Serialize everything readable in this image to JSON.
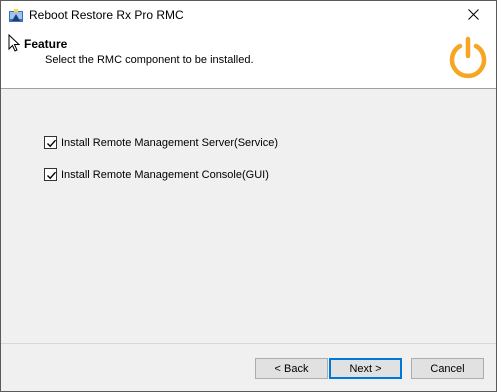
{
  "window": {
    "title": "Reboot Restore Rx Pro RMC",
    "app_icon": "installer-icon",
    "close_icon": "close-icon"
  },
  "header": {
    "title": "Feature",
    "subtitle": "Select the RMC component to be installed.",
    "logo_icon": "power-icon",
    "accent_color": "#f5a623"
  },
  "options": [
    {
      "label": "Install Remote Management Server(Service)",
      "checked": true
    },
    {
      "label": "Install Remote Management Console(GUI)",
      "checked": true
    }
  ],
  "buttons": {
    "back": "< Back",
    "next": "Next >",
    "cancel": "Cancel"
  }
}
